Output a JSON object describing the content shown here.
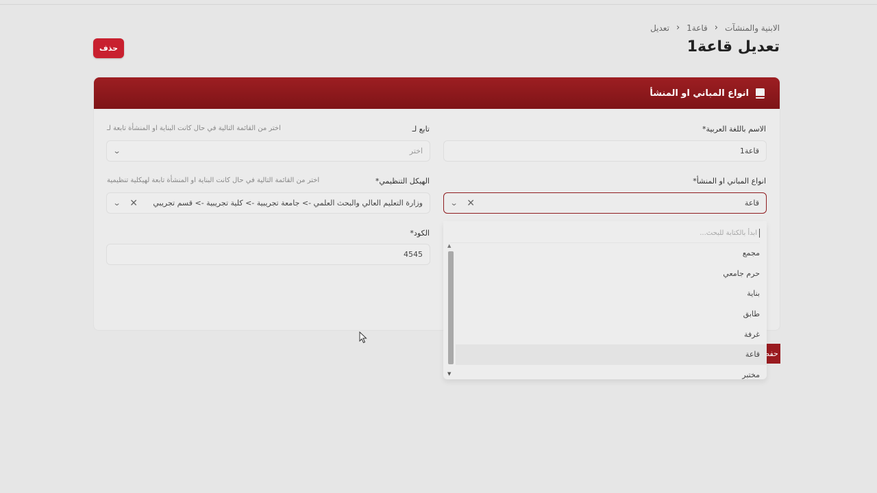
{
  "breadcrumb": {
    "items": [
      "الابنية والمنشآت",
      "قاعة1",
      "تعديل"
    ]
  },
  "page": {
    "title": "تعديل قاعة1"
  },
  "actions": {
    "delete_label": "حذف",
    "save_label": "حفظ"
  },
  "card": {
    "title": "انواع المباني او المنشأ",
    "icon": "book-icon"
  },
  "form": {
    "name_ar": {
      "label": "الاسم باللغة العربية",
      "required": "*",
      "value": "قاعة1"
    },
    "parent": {
      "label": "تابع لـ",
      "hint": "اختر من القائمة التالية في حال كانت البناية او المنشأة تابعة لـ",
      "placeholder": "اختر"
    },
    "building_type": {
      "label": "انواع المباني او المنشأ",
      "required": "*",
      "value": "قاعة"
    },
    "org_structure": {
      "label": "الهيكل التنظيمي",
      "required": "*",
      "hint": "اختر من القائمة التالية في حال كانت البناية او المنشأة تابعة لهيكلية تنظيمية",
      "value": "وزارة التعليم العالي والبحث العلمي -> جامعة تجريبية -> كلية تجريبية -> قسم تجريبي"
    },
    "code": {
      "label": "الكود",
      "required": "*",
      "value": "4545"
    }
  },
  "dropdown": {
    "search_placeholder": "ابدأ بالكتابة للبحث...",
    "options": [
      "مجمع",
      "حرم جامعي",
      "بناية",
      "طابق",
      "غرفة",
      "قاعة",
      "مختبر"
    ],
    "selected": "قاعة"
  },
  "colors": {
    "brand": "#8f1c1f",
    "danger": "#c8202f",
    "background": "#e6e6e6"
  }
}
